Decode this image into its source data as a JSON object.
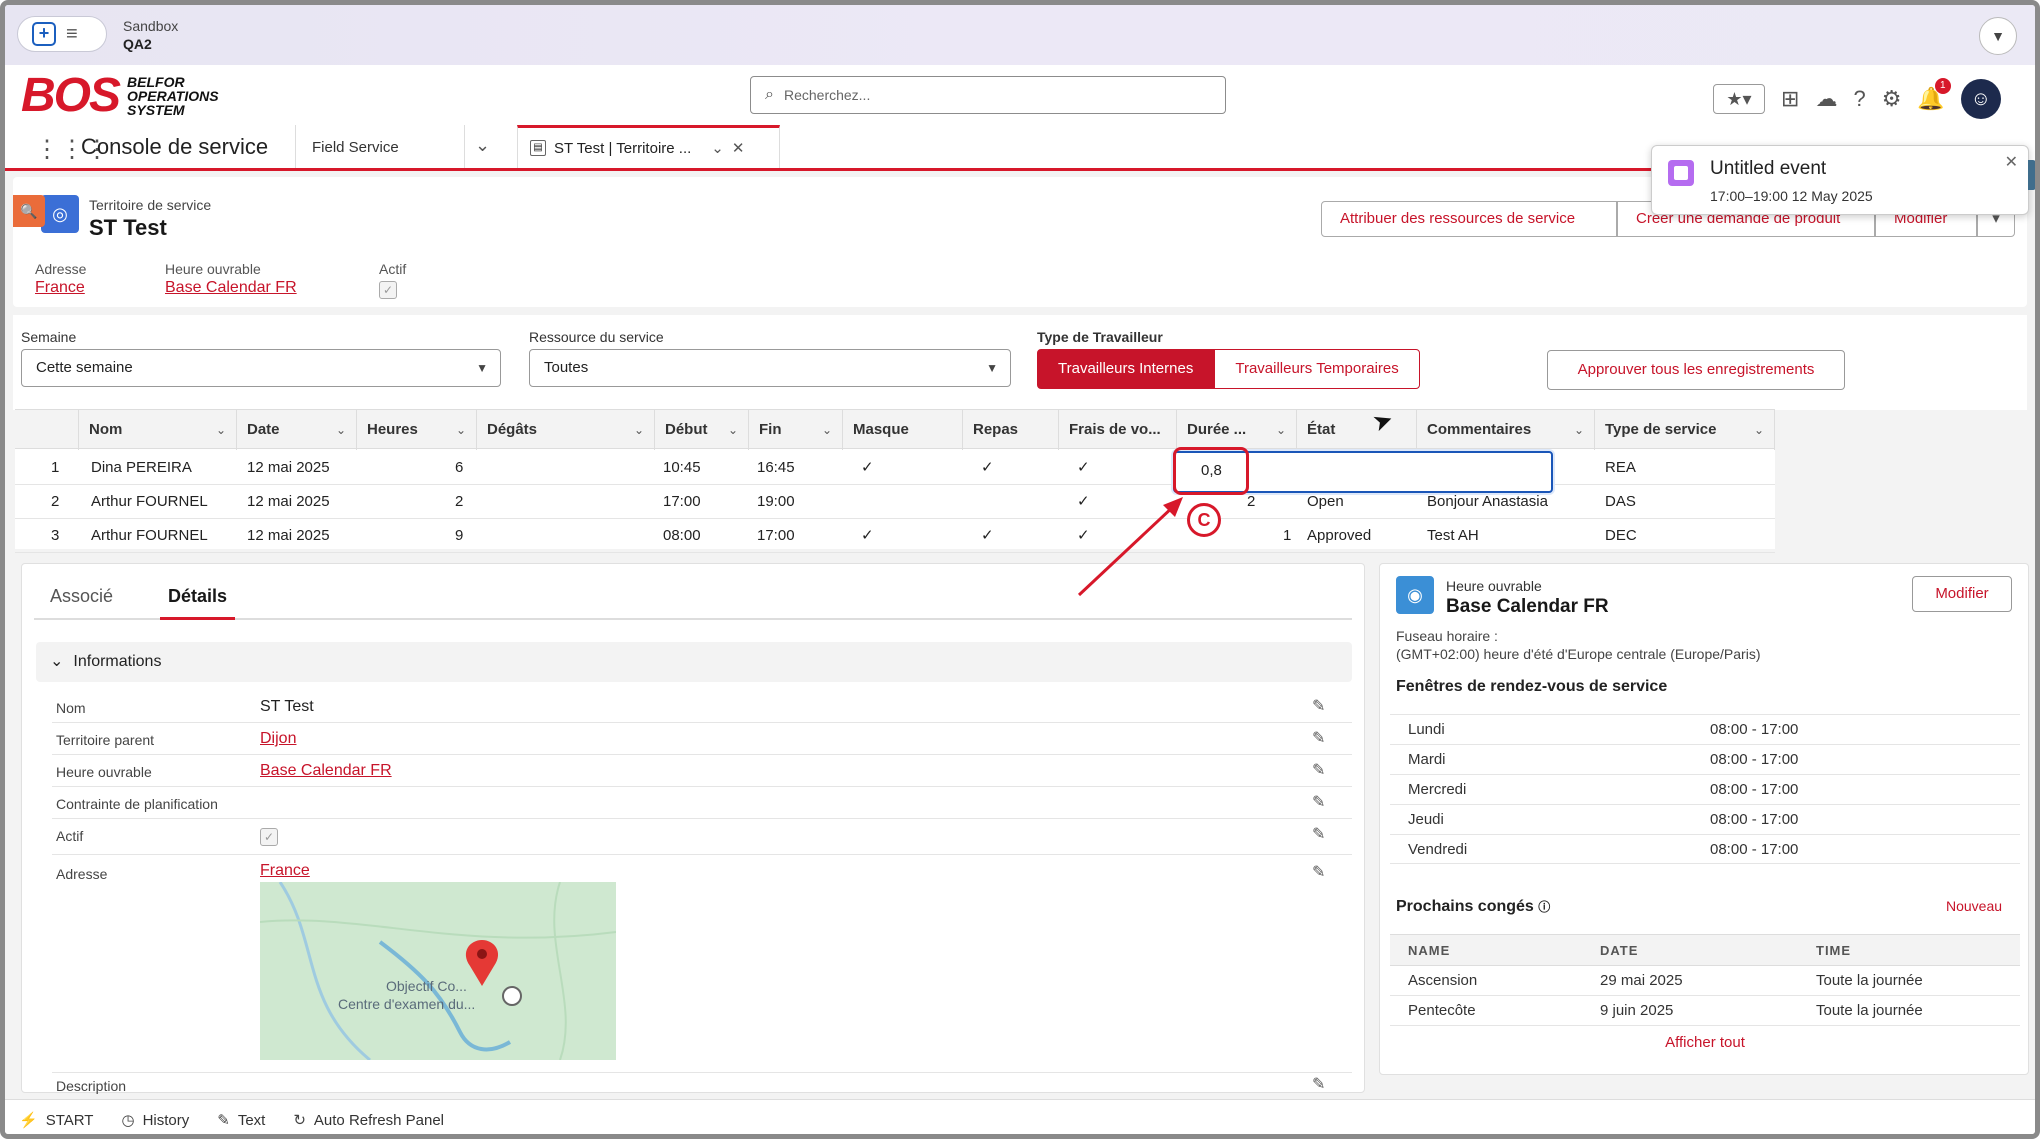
{
  "sandbox": {
    "label": "Sandbox",
    "org": "QA2"
  },
  "brand": {
    "logo_text": "BOS",
    "logo_sub": [
      "BELFOR",
      "OPERATIONS",
      "SYSTEM"
    ],
    "accent": "#d7182a"
  },
  "header": {
    "search_placeholder": "Recherchez...",
    "notification_count": "1"
  },
  "nav": {
    "app_name": "Console de service",
    "object_tab": "Field Service",
    "record_tab": "ST Test | Territoire ..."
  },
  "toast": {
    "title": "Untitled event",
    "time": "17:00–19:00 12 May 2025"
  },
  "record": {
    "type_label": "Territoire de service",
    "name": "ST Test",
    "buttons": [
      "Attribuer des ressources de service",
      "Créer une demande de produit",
      "Modifier"
    ],
    "fields": {
      "address_label": "Adresse",
      "address_value": "France",
      "hours_label": "Heure ouvrable",
      "hours_value": "Base Calendar FR",
      "active_label": "Actif"
    }
  },
  "filters": {
    "week_label": "Semaine",
    "week_value": "Cette semaine",
    "resource_label": "Ressource du service",
    "resource_value": "Toutes",
    "worker_type_label": "Type de Travailleur",
    "worker_internal": "Travailleurs Internes",
    "worker_temp": "Travailleurs Temporaires",
    "approve_all": "Approuver tous les enregistrements"
  },
  "table": {
    "columns": [
      "Nom",
      "Date",
      "Heures",
      "Dégâts",
      "Début",
      "Fin",
      "Masque",
      "Repas",
      "Frais de vo...",
      "Durée ...",
      "État",
      "Commentaires",
      "Type de service"
    ],
    "rows": [
      {
        "n": "1",
        "nom": "Dina PEREIRA",
        "date": "12 mai 2025",
        "heures": "6",
        "degats": "",
        "debut": "10:45",
        "fin": "16:45",
        "masque": "✓",
        "repas": "✓",
        "frais": "✓",
        "duree": "",
        "etat": "",
        "comment": "",
        "type": "REA"
      },
      {
        "n": "2",
        "nom": "Arthur FOURNEL",
        "date": "12 mai 2025",
        "heures": "2",
        "degats": "",
        "debut": "17:00",
        "fin": "19:00",
        "masque": "",
        "repas": "",
        "frais": "✓",
        "duree": "2",
        "etat": "Open",
        "comment": "Bonjour Anastasia",
        "type": "DAS"
      },
      {
        "n": "3",
        "nom": "Arthur FOURNEL",
        "date": "12 mai 2025",
        "heures": "9",
        "degats": "",
        "debut": "08:00",
        "fin": "17:00",
        "masque": "✓",
        "repas": "✓",
        "frais": "✓",
        "duree": "1",
        "etat": "Approved",
        "comment": "Test AH",
        "type": "DEC"
      }
    ],
    "editing_value": "0,8",
    "marker": "C"
  },
  "details": {
    "tab_associated": "Associé",
    "tab_details": "Détails",
    "section": "Informations",
    "fields": [
      {
        "label": "Nom",
        "value": "ST Test"
      },
      {
        "label": "Territoire parent",
        "value": "Dijon"
      },
      {
        "label": "Heure ouvrable",
        "value": "Base Calendar FR"
      },
      {
        "label": "Contrainte de planification",
        "value": ""
      },
      {
        "label": "Actif",
        "value": ""
      },
      {
        "label": "Adresse",
        "value": "France"
      }
    ],
    "description_label": "Description",
    "map_caption_1": "Objectif Co...",
    "map_caption_2": "Centre d'examen du..."
  },
  "hours_card": {
    "subtitle": "Heure ouvrable",
    "title": "Base Calendar FR",
    "edit": "Modifier",
    "tz_label": "Fuseau horaire :",
    "tz_value": "(GMT+02:00) heure d'été d'Europe centrale (Europe/Paris)",
    "windows_title": "Fenêtres de rendez-vous de service",
    "days": [
      {
        "day": "Lundi",
        "hours": "08:00 - 17:00"
      },
      {
        "day": "Mardi",
        "hours": "08:00 - 17:00"
      },
      {
        "day": "Mercredi",
        "hours": "08:00 - 17:00"
      },
      {
        "day": "Jeudi",
        "hours": "08:00 - 17:00"
      },
      {
        "day": "Vendredi",
        "hours": "08:00 - 17:00"
      }
    ],
    "holidays_title": "Prochains congés",
    "new": "Nouveau",
    "holiday_cols": [
      "NAME",
      "DATE",
      "TIME"
    ],
    "holidays": [
      {
        "name": "Ascension",
        "date": "29 mai 2025",
        "time": "Toute la journée"
      },
      {
        "name": "Pentecôte",
        "date": "9 juin 2025",
        "time": "Toute la journée"
      }
    ],
    "show_all": "Afficher tout"
  },
  "footer": {
    "items": [
      "START",
      "History",
      "Text",
      "Auto Refresh Panel"
    ]
  }
}
